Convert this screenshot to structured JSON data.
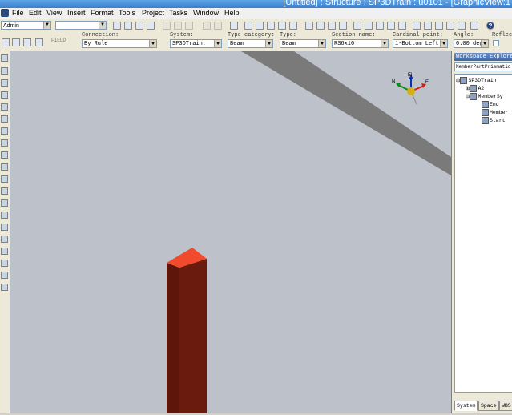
{
  "window": {
    "title": "[Untitled] : Structure : SP3DTrain : u0101 - [GraphicView:1"
  },
  "menu": [
    "File",
    "Edit",
    "View",
    "Insert",
    "Format",
    "Tools",
    "Project",
    "Tasks",
    "Window",
    "Help"
  ],
  "toolbar": {
    "permission_group": "Admin",
    "filter_value": "",
    "help_label": "?"
  },
  "ribbon": {
    "fields": [
      {
        "label": "Connection:",
        "value": "By Rule"
      },
      {
        "label": "System:",
        "value": "SP3DTrain."
      },
      {
        "label": "Type category:",
        "value": "Beam"
      },
      {
        "label": "Type:",
        "value": "Beam"
      },
      {
        "label": "Section name:",
        "value": "RS6x10"
      },
      {
        "label": "Cardinal point:",
        "value": "1-Bottom Left"
      },
      {
        "label": "Angle:",
        "value": "0.00 deg"
      },
      {
        "label": "Reflect",
        "value": ""
      }
    ],
    "pick_label": "FIELD"
  },
  "compass": {
    "el_label": "El",
    "n_label": "N",
    "e_label": "E"
  },
  "explorer": {
    "title": "Workspace Explorer",
    "filter": "MemberPartPrismatic",
    "tree": [
      "SP3DTrain",
      "A2",
      "MemberSy",
      "End",
      "Member",
      "Start"
    ],
    "tabs": [
      "System",
      "Space",
      "WBS"
    ]
  },
  "colors": {
    "viewport": "#bdc2ca",
    "column_front": "#6b1a0e",
    "column_top": "#f24a2c",
    "beam": "#7a7a7a"
  }
}
